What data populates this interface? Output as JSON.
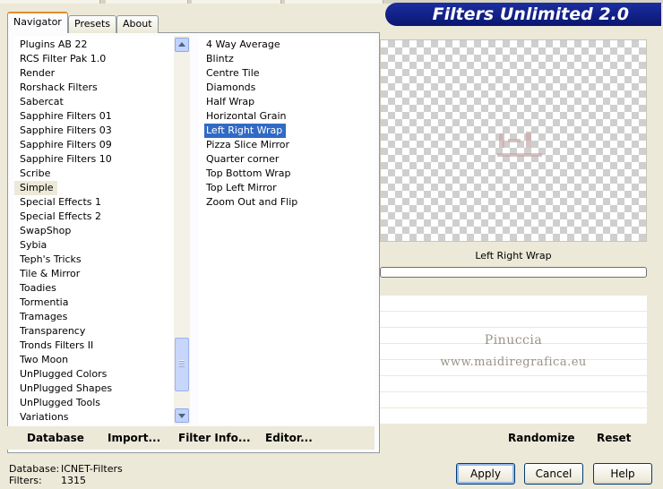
{
  "window": {
    "banner_title": "Filters Unlimited 2.0"
  },
  "tabs": [
    {
      "label": "Navigator",
      "active": true
    },
    {
      "label": "Presets",
      "active": false
    },
    {
      "label": "About",
      "active": false
    }
  ],
  "categories": {
    "items": [
      "Plugins AB 22",
      "RCS Filter Pak 1.0",
      "Render",
      "Rorshack Filters",
      "Sabercat",
      "Sapphire Filters 01",
      "Sapphire Filters 03",
      "Sapphire Filters 09",
      "Sapphire Filters 10",
      "Scribe",
      "Simple",
      "Special Effects 1",
      "Special Effects 2",
      "SwapShop",
      "Sybia",
      "Teph's Tricks",
      "Tile & Mirror",
      "Toadies",
      "Tormentia",
      "Tramages",
      "Transparency",
      "Tronds Filters II",
      "Two Moon",
      "UnPlugged Colors",
      "UnPlugged Shapes",
      "UnPlugged Tools",
      "Variations"
    ],
    "selected": "Simple"
  },
  "filters": {
    "items": [
      "4 Way Average",
      "Blintz",
      "Centre Tile",
      "Diamonds",
      "Half Wrap",
      "Horizontal Grain",
      "Left Right Wrap",
      "Pizza Slice Mirror",
      "Quarter corner",
      "Top Bottom Wrap",
      "Top Left Mirror",
      "Zoom Out and Flip"
    ],
    "selected": "Left Right Wrap"
  },
  "commands": {
    "database": "Database",
    "import": "Import...",
    "filter_info": "Filter Info...",
    "editor": "Editor...",
    "randomize": "Randomize",
    "reset": "Reset"
  },
  "preview": {
    "filter_name": "Left Right Wrap"
  },
  "watermark": {
    "line1": "Pinuccia",
    "line2": "www.maidiregrafica.eu"
  },
  "status": {
    "database_label": "Database:",
    "database_value": "ICNET-Filters",
    "filters_label": "Filters:",
    "filters_value": "1315"
  },
  "buttons": {
    "apply": "Apply",
    "cancel": "Cancel",
    "help": "Help"
  }
}
